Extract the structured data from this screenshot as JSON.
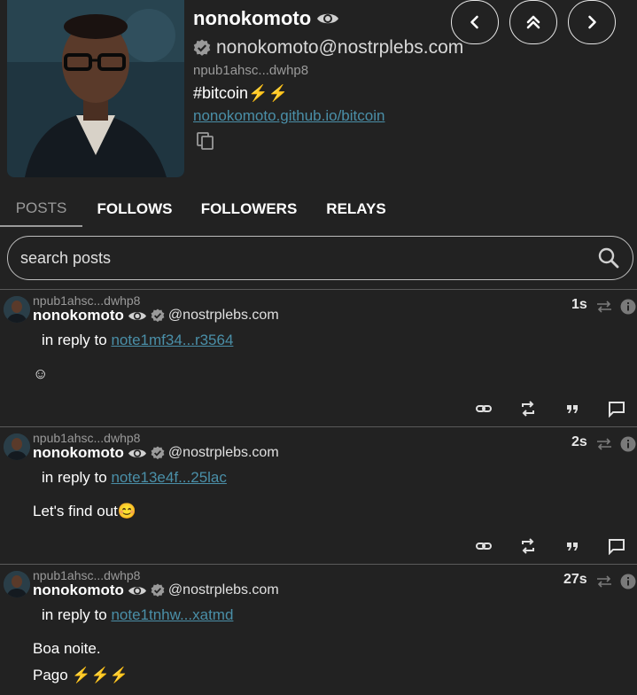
{
  "profile": {
    "name": "nonokomoto",
    "nip05": "nonokomoto@nostrplebs.com",
    "npub": "npub1ahsc...dwhp8",
    "about": "#bitcoin⚡⚡",
    "website": "nonokomoto.github.io/bitcoin"
  },
  "tabs": [
    {
      "label": "POSTS"
    },
    {
      "label": "FOLLOWS"
    },
    {
      "label": "FOLLOWERS"
    },
    {
      "label": "RELAYS"
    }
  ],
  "search": {
    "placeholder": "search posts"
  },
  "posts": [
    {
      "npub": "npub1ahsc...dwhp8",
      "author": "nonokomoto",
      "domain": "@nostrplebs.com",
      "reply_prefix": "in reply to ",
      "reply_note": "note1mf34...r3564",
      "body": [
        "☺"
      ],
      "time": "1s"
    },
    {
      "npub": "npub1ahsc...dwhp8",
      "author": "nonokomoto",
      "domain": "@nostrplebs.com",
      "reply_prefix": "in reply to ",
      "reply_note": "note13e4f...25lac",
      "body": [
        "Let's find out😊"
      ],
      "time": "2s"
    },
    {
      "npub": "npub1ahsc...dwhp8",
      "author": "nonokomoto",
      "domain": "@nostrplebs.com",
      "reply_prefix": "in reply to ",
      "reply_note": "note1tnhw...xatmd",
      "body": [
        "Boa noite.",
        "Pago ⚡⚡⚡"
      ],
      "time": "27s"
    }
  ],
  "icons": {
    "nav_back": "chevron-left-icon",
    "nav_top": "double-chevron-up-icon",
    "nav_forward": "chevron-right-icon",
    "copy": "copy-icon",
    "search": "search-icon",
    "eye": "eye-icon",
    "verified": "verified-badge-icon",
    "repost": "repost-icon",
    "info": "info-icon",
    "link": "link-icon",
    "quote": "quote-icon",
    "reply": "reply-icon"
  },
  "colors": {
    "background": "#222222",
    "link": "#4a8fa8",
    "muted": "#9a9a9a",
    "divider": "#5a5a5a"
  }
}
